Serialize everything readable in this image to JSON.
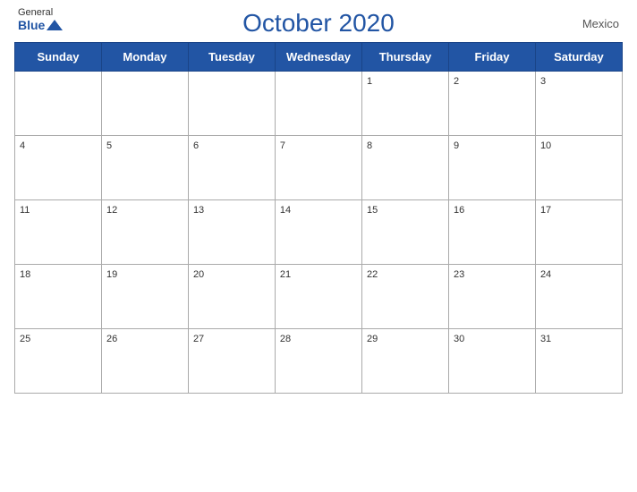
{
  "header": {
    "logo": {
      "general": "General",
      "blue": "Blue",
      "bird_unicode": "▲"
    },
    "title": "October 2020",
    "country": "Mexico"
  },
  "calendar": {
    "weekdays": [
      "Sunday",
      "Monday",
      "Tuesday",
      "Wednesday",
      "Thursday",
      "Friday",
      "Saturday"
    ],
    "weeks": [
      [
        "",
        "",
        "",
        "",
        "1",
        "2",
        "3"
      ],
      [
        "4",
        "5",
        "6",
        "7",
        "8",
        "9",
        "10"
      ],
      [
        "11",
        "12",
        "13",
        "14",
        "15",
        "16",
        "17"
      ],
      [
        "18",
        "19",
        "20",
        "21",
        "22",
        "23",
        "24"
      ],
      [
        "25",
        "26",
        "27",
        "28",
        "29",
        "30",
        "31"
      ]
    ]
  }
}
